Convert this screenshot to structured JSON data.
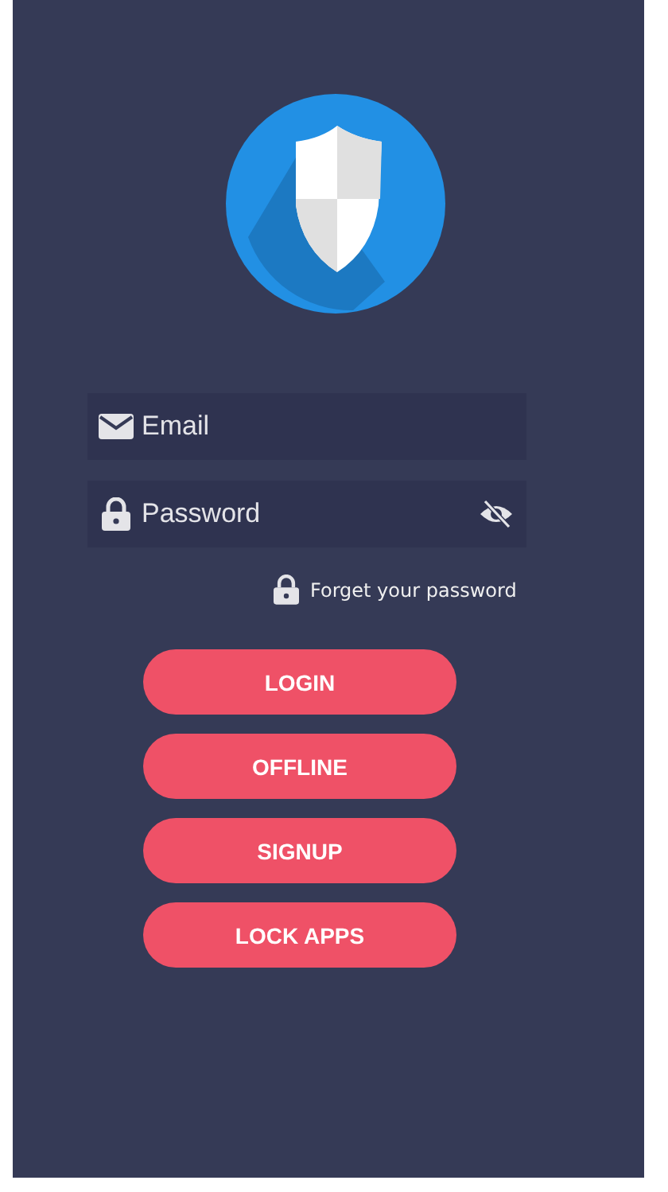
{
  "email_field": {
    "placeholder": "Email"
  },
  "password_field": {
    "placeholder": "Password"
  },
  "forgot_link": "Forget your password",
  "buttons": [
    "LOGIN",
    "OFFLINE",
    "SIGNUP",
    "LOCK APPS"
  ]
}
